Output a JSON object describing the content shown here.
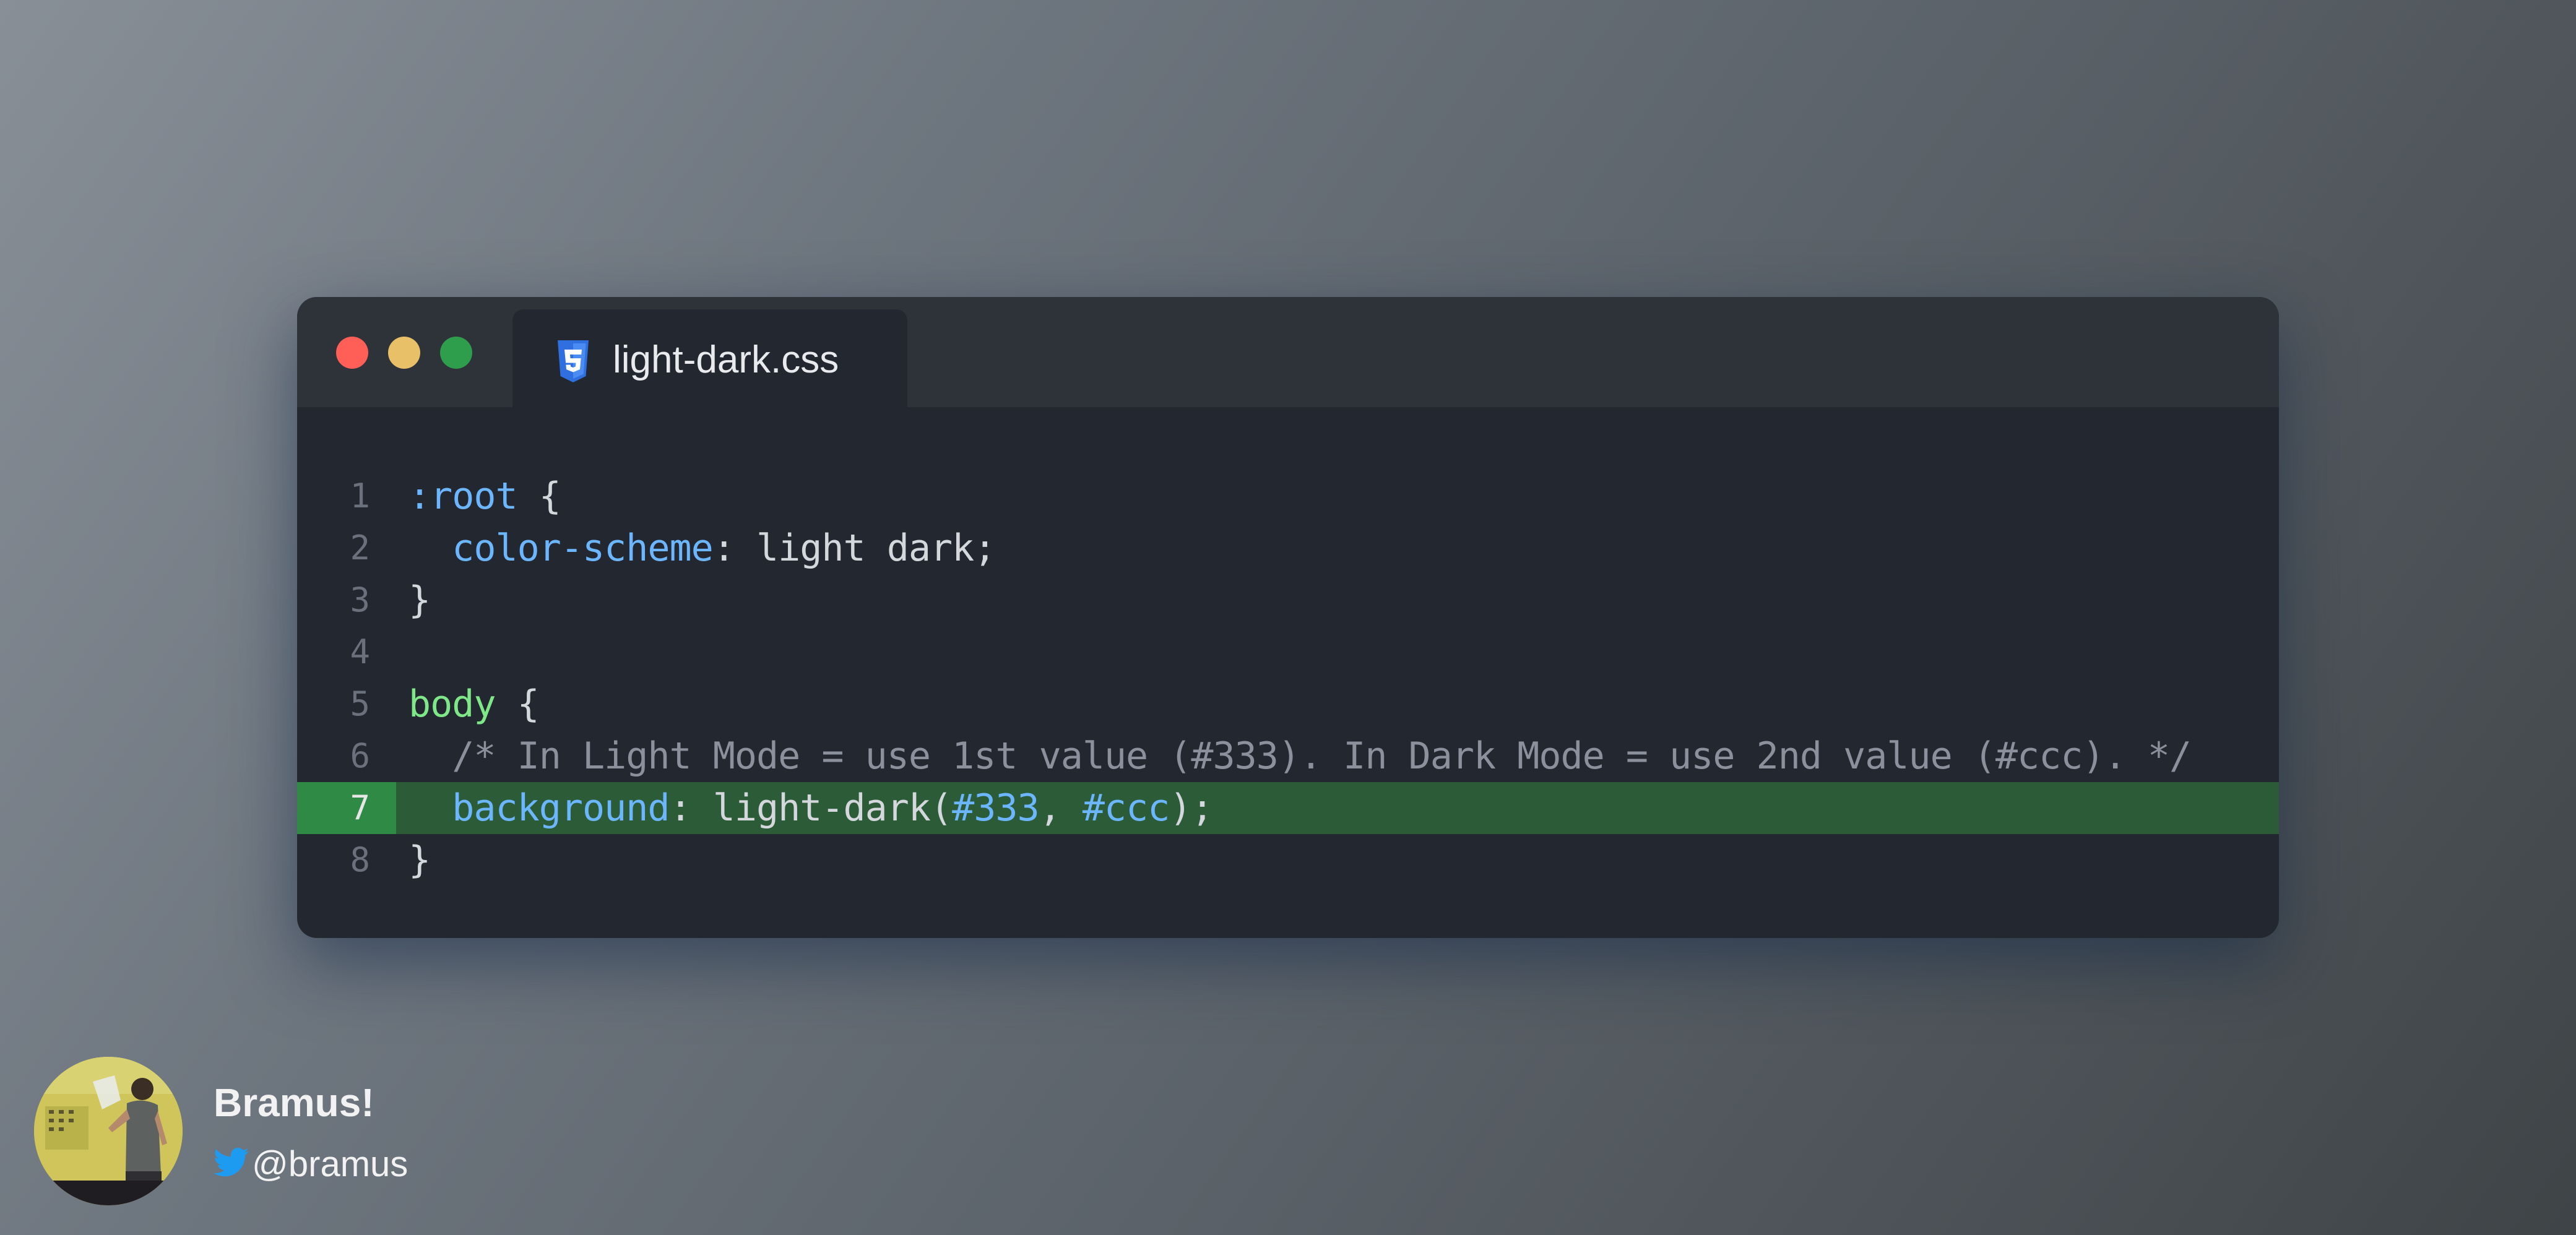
{
  "window": {
    "tab": {
      "icon": "css3-icon",
      "label": "light-dark.css"
    },
    "traffic_lights": {
      "close": "#ff5f57",
      "minimize": "#e7c068",
      "maximize": "#2e9d4c"
    }
  },
  "editor": {
    "highlighted_line": 7,
    "lines": [
      {
        "number": "1",
        "tokens": [
          {
            "t": ":root",
            "c": "sel"
          },
          {
            "t": " {",
            "c": "txt"
          }
        ]
      },
      {
        "number": "2",
        "tokens": [
          {
            "t": "  ",
            "c": "txt"
          },
          {
            "t": "color-scheme",
            "c": "prop"
          },
          {
            "t": ": light dark;",
            "c": "txt"
          }
        ]
      },
      {
        "number": "3",
        "tokens": [
          {
            "t": "}",
            "c": "txt"
          }
        ]
      },
      {
        "number": "4",
        "tokens": []
      },
      {
        "number": "5",
        "tokens": [
          {
            "t": "body",
            "c": "tag"
          },
          {
            "t": " {",
            "c": "txt"
          }
        ]
      },
      {
        "number": "6",
        "tokens": [
          {
            "t": "  /* In Light Mode = use 1st value (#333). In Dark Mode = use 2nd value (#ccc). */",
            "c": "com"
          }
        ]
      },
      {
        "number": "7",
        "tokens": [
          {
            "t": "  ",
            "c": "txt"
          },
          {
            "t": "background",
            "c": "prop"
          },
          {
            "t": ": light-dark(",
            "c": "txt"
          },
          {
            "t": "#333",
            "c": "hex"
          },
          {
            "t": ", ",
            "c": "txt"
          },
          {
            "t": "#ccc",
            "c": "hex"
          },
          {
            "t": ");",
            "c": "txt"
          }
        ]
      },
      {
        "number": "8",
        "tokens": [
          {
            "t": "}",
            "c": "txt"
          }
        ]
      }
    ]
  },
  "author": {
    "name": "Bramus!",
    "handle": "@bramus",
    "handle_icon": "twitter-icon",
    "twitter_color": "#1d9bf0"
  }
}
